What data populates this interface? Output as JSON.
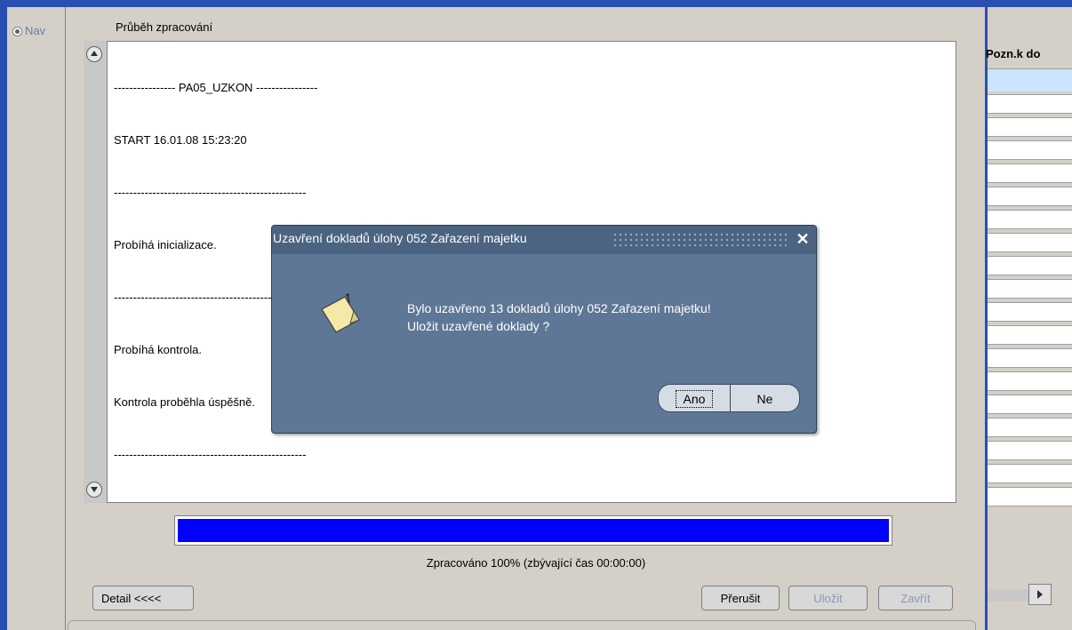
{
  "nav": {
    "label": "Nav"
  },
  "main": {
    "title": "Průběh zpracování",
    "log_lines": [
      "---------------- PA05_UZKON ----------------",
      "START 16.01.08 15:23:20",
      "--------------------------------------------------",
      "Probíhá inicializace.",
      "--------------------------------------------------",
      "Probíhá kontrola.",
      "Kontrola proběhla úspěšně.",
      "--------------------------------------------------"
    ],
    "progress": {
      "percent": 100,
      "fill_color": "#0000ff",
      "label": "Zpracováno 100% (zbývající čas 00:00:00)"
    },
    "buttons": {
      "detail": "Detail  <<<<",
      "prerusit": "Přerušit",
      "ulozit": "Uložit",
      "zavrit": "Zavřít"
    }
  },
  "right": {
    "column_header": "Pozn.k do"
  },
  "dialog": {
    "title": "Uzavření dokladů úlohy 052 Zařazení majetku",
    "message_line1": "Bylo uzavřeno 13 dokladů úlohy 052 Zařazení majetku!",
    "message_line2": "Uložit uzavřené doklady ?",
    "ano": "Ano",
    "ne": "Ne",
    "close": "✕",
    "icon": "note-icon"
  },
  "colors": {
    "frame_blue": "#2a4fb3",
    "dialog_bg": "#5f7796",
    "selected_row": "#cce4ff"
  }
}
